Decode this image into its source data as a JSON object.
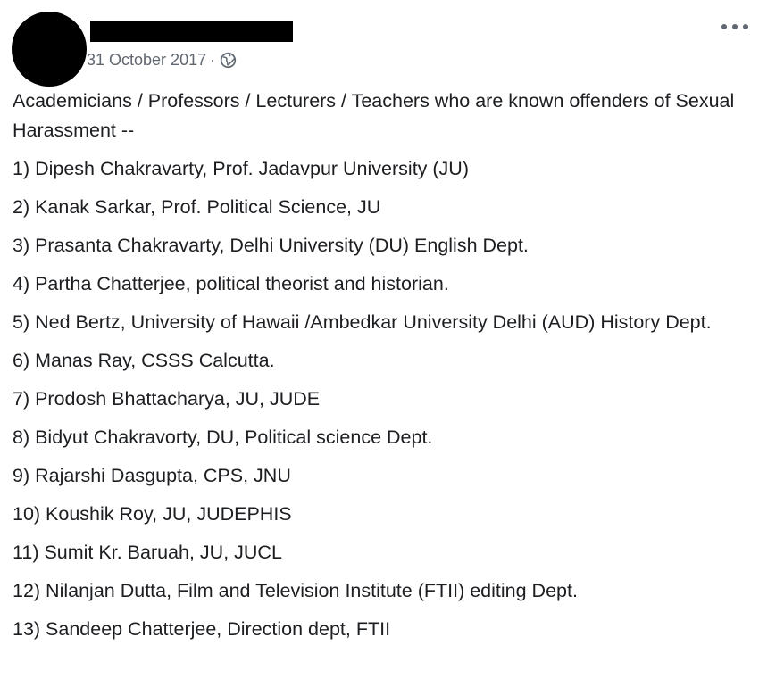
{
  "post": {
    "date": "31 October 2017",
    "separator": "·",
    "privacy_icon": "globe-icon",
    "more_icon": "more-options-icon",
    "intro": "Academicians / Professors / Lecturers / Teachers who are known offenders of Sexual Harassment --",
    "items": [
      "1) Dipesh Chakravarty, Prof. Jadavpur University (JU)",
      "2) Kanak Sarkar, Prof. Political Science, JU",
      "3) Prasanta Chakravarty, Delhi University (DU) English Dept.",
      "4) Partha Chatterjee, political theorist and historian.",
      "5) Ned Bertz, University of Hawaii /Ambedkar University Delhi (AUD) History Dept.",
      "6) Manas Ray, CSSS Calcutta.",
      "7) Prodosh Bhattacharya, JU, JUDE",
      "8) Bidyut Chakravorty, DU, Political science Dept.",
      "9) Rajarshi Dasgupta, CPS, JNU",
      "10) Koushik Roy, JU, JUDEPHIS",
      "11) Sumit Kr. Baruah, JU, JUCL",
      "12) Nilanjan Dutta, Film and Television Institute (FTII) editing Dept.",
      "13) Sandeep Chatterjee, Direction dept, FTII"
    ]
  },
  "colors": {
    "text": "#1c1e21",
    "meta": "#616770",
    "redaction": "#000000"
  }
}
